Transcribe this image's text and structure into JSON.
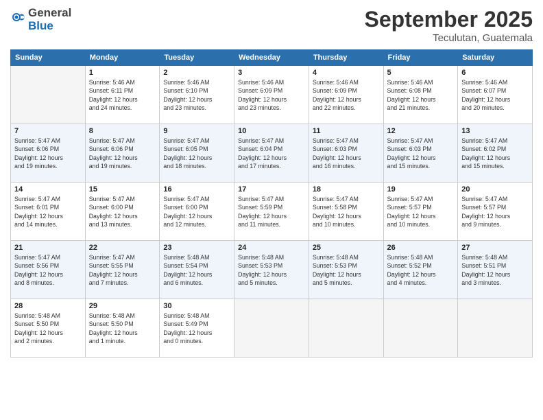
{
  "logo": {
    "general": "General",
    "blue": "Blue"
  },
  "title": "September 2025",
  "subtitle": "Teculutan, Guatemala",
  "days": [
    "Sunday",
    "Monday",
    "Tuesday",
    "Wednesday",
    "Thursday",
    "Friday",
    "Saturday"
  ],
  "weeks": [
    [
      {
        "day": "",
        "info": ""
      },
      {
        "day": "1",
        "info": "Sunrise: 5:46 AM\nSunset: 6:11 PM\nDaylight: 12 hours\nand 24 minutes."
      },
      {
        "day": "2",
        "info": "Sunrise: 5:46 AM\nSunset: 6:10 PM\nDaylight: 12 hours\nand 23 minutes."
      },
      {
        "day": "3",
        "info": "Sunrise: 5:46 AM\nSunset: 6:09 PM\nDaylight: 12 hours\nand 23 minutes."
      },
      {
        "day": "4",
        "info": "Sunrise: 5:46 AM\nSunset: 6:09 PM\nDaylight: 12 hours\nand 22 minutes."
      },
      {
        "day": "5",
        "info": "Sunrise: 5:46 AM\nSunset: 6:08 PM\nDaylight: 12 hours\nand 21 minutes."
      },
      {
        "day": "6",
        "info": "Sunrise: 5:46 AM\nSunset: 6:07 PM\nDaylight: 12 hours\nand 20 minutes."
      }
    ],
    [
      {
        "day": "7",
        "info": "Sunrise: 5:47 AM\nSunset: 6:06 PM\nDaylight: 12 hours\nand 19 minutes."
      },
      {
        "day": "8",
        "info": "Sunrise: 5:47 AM\nSunset: 6:06 PM\nDaylight: 12 hours\nand 19 minutes."
      },
      {
        "day": "9",
        "info": "Sunrise: 5:47 AM\nSunset: 6:05 PM\nDaylight: 12 hours\nand 18 minutes."
      },
      {
        "day": "10",
        "info": "Sunrise: 5:47 AM\nSunset: 6:04 PM\nDaylight: 12 hours\nand 17 minutes."
      },
      {
        "day": "11",
        "info": "Sunrise: 5:47 AM\nSunset: 6:03 PM\nDaylight: 12 hours\nand 16 minutes."
      },
      {
        "day": "12",
        "info": "Sunrise: 5:47 AM\nSunset: 6:03 PM\nDaylight: 12 hours\nand 15 minutes."
      },
      {
        "day": "13",
        "info": "Sunrise: 5:47 AM\nSunset: 6:02 PM\nDaylight: 12 hours\nand 15 minutes."
      }
    ],
    [
      {
        "day": "14",
        "info": "Sunrise: 5:47 AM\nSunset: 6:01 PM\nDaylight: 12 hours\nand 14 minutes."
      },
      {
        "day": "15",
        "info": "Sunrise: 5:47 AM\nSunset: 6:00 PM\nDaylight: 12 hours\nand 13 minutes."
      },
      {
        "day": "16",
        "info": "Sunrise: 5:47 AM\nSunset: 6:00 PM\nDaylight: 12 hours\nand 12 minutes."
      },
      {
        "day": "17",
        "info": "Sunrise: 5:47 AM\nSunset: 5:59 PM\nDaylight: 12 hours\nand 11 minutes."
      },
      {
        "day": "18",
        "info": "Sunrise: 5:47 AM\nSunset: 5:58 PM\nDaylight: 12 hours\nand 10 minutes."
      },
      {
        "day": "19",
        "info": "Sunrise: 5:47 AM\nSunset: 5:57 PM\nDaylight: 12 hours\nand 10 minutes."
      },
      {
        "day": "20",
        "info": "Sunrise: 5:47 AM\nSunset: 5:57 PM\nDaylight: 12 hours\nand 9 minutes."
      }
    ],
    [
      {
        "day": "21",
        "info": "Sunrise: 5:47 AM\nSunset: 5:56 PM\nDaylight: 12 hours\nand 8 minutes."
      },
      {
        "day": "22",
        "info": "Sunrise: 5:47 AM\nSunset: 5:55 PM\nDaylight: 12 hours\nand 7 minutes."
      },
      {
        "day": "23",
        "info": "Sunrise: 5:48 AM\nSunset: 5:54 PM\nDaylight: 12 hours\nand 6 minutes."
      },
      {
        "day": "24",
        "info": "Sunrise: 5:48 AM\nSunset: 5:53 PM\nDaylight: 12 hours\nand 5 minutes."
      },
      {
        "day": "25",
        "info": "Sunrise: 5:48 AM\nSunset: 5:53 PM\nDaylight: 12 hours\nand 5 minutes."
      },
      {
        "day": "26",
        "info": "Sunrise: 5:48 AM\nSunset: 5:52 PM\nDaylight: 12 hours\nand 4 minutes."
      },
      {
        "day": "27",
        "info": "Sunrise: 5:48 AM\nSunset: 5:51 PM\nDaylight: 12 hours\nand 3 minutes."
      }
    ],
    [
      {
        "day": "28",
        "info": "Sunrise: 5:48 AM\nSunset: 5:50 PM\nDaylight: 12 hours\nand 2 minutes."
      },
      {
        "day": "29",
        "info": "Sunrise: 5:48 AM\nSunset: 5:50 PM\nDaylight: 12 hours\nand 1 minute."
      },
      {
        "day": "30",
        "info": "Sunrise: 5:48 AM\nSunset: 5:49 PM\nDaylight: 12 hours\nand 0 minutes."
      },
      {
        "day": "",
        "info": ""
      },
      {
        "day": "",
        "info": ""
      },
      {
        "day": "",
        "info": ""
      },
      {
        "day": "",
        "info": ""
      }
    ]
  ]
}
